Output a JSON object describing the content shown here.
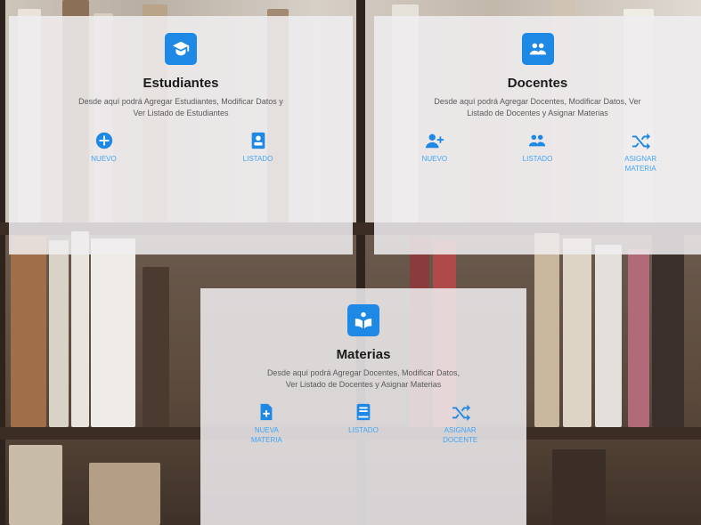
{
  "cards": {
    "estudiantes": {
      "title": "Estudiantes",
      "desc_line1": "Desde aquí podrá Agregar Estudiantes, Modificar Datos y",
      "desc_line2": "Ver Listado de Estudiantes",
      "icon": "student-graduate-icon",
      "actions": [
        {
          "line1": "NUEVO",
          "line2": "",
          "icon": "plus-circle-icon"
        },
        {
          "line1": "LISTADO",
          "line2": "",
          "icon": "address-card-icon"
        }
      ]
    },
    "docentes": {
      "title": "Docentes",
      "desc_line1": "Desde aquí podrá Agregar Docentes, Modificar Datos, Ver",
      "desc_line2": "Listado de Docentes y Asignar Materias",
      "icon": "users-icon",
      "actions": [
        {
          "line1": "NUEVO",
          "line2": "",
          "icon": "user-plus-icon"
        },
        {
          "line1": "LISTADO",
          "line2": "",
          "icon": "users-icon"
        },
        {
          "line1": "ASIGNAR",
          "line2": "MATERIA",
          "icon": "shuffle-icon"
        }
      ]
    },
    "materias": {
      "title": "Materias",
      "desc_line1": "Desde aquí podrá Agregar Docentes, Modificar Datos,",
      "desc_line2": "Ver Listado de Docentes y Asignar Materias",
      "icon": "book-reader-icon",
      "actions": [
        {
          "line1": "NUEVA",
          "line2": "MATERIA",
          "icon": "file-plus-icon"
        },
        {
          "line1": "LISTADO",
          "line2": "",
          "icon": "book-icon"
        },
        {
          "line1": "ASIGNAR",
          "line2": "DOCENTE",
          "icon": "shuffle-icon"
        }
      ]
    }
  },
  "colors": {
    "accent": "#1e88e5",
    "link": "#42a5f5",
    "card_bg": "#f0eef0"
  }
}
